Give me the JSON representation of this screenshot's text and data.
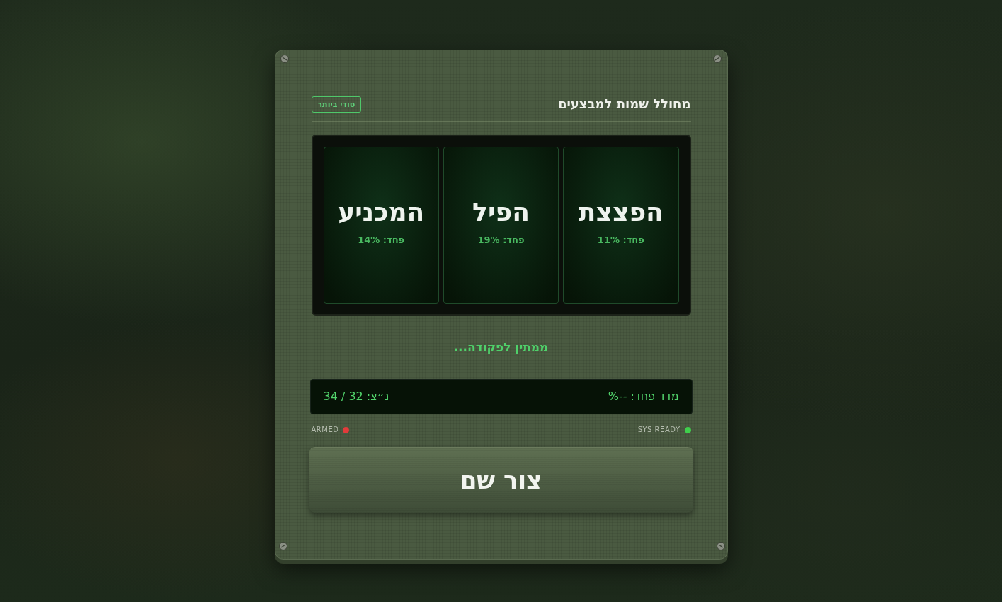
{
  "panel": {
    "title": "מחולל שמות למבצעים",
    "badge": "סודי ביותר"
  },
  "reels": [
    {
      "name": "הפצצת",
      "fear": "פחד: 11%"
    },
    {
      "name": "הפיל",
      "fear": "פחד: 19%"
    },
    {
      "name": "המכניע",
      "fear": "פחד: 14%"
    }
  ],
  "status": "ממתין לפקודה...",
  "readout": {
    "fear_index": "מדד פחד: --%",
    "coordinates": "נ״צ: 32 / 34"
  },
  "indicators": [
    {
      "label": "SYS READY",
      "color": "#3fcf4c"
    },
    {
      "label": "ARMED",
      "color": "#e23b3b"
    }
  ],
  "generate_button": {
    "label": "צור שם"
  }
}
